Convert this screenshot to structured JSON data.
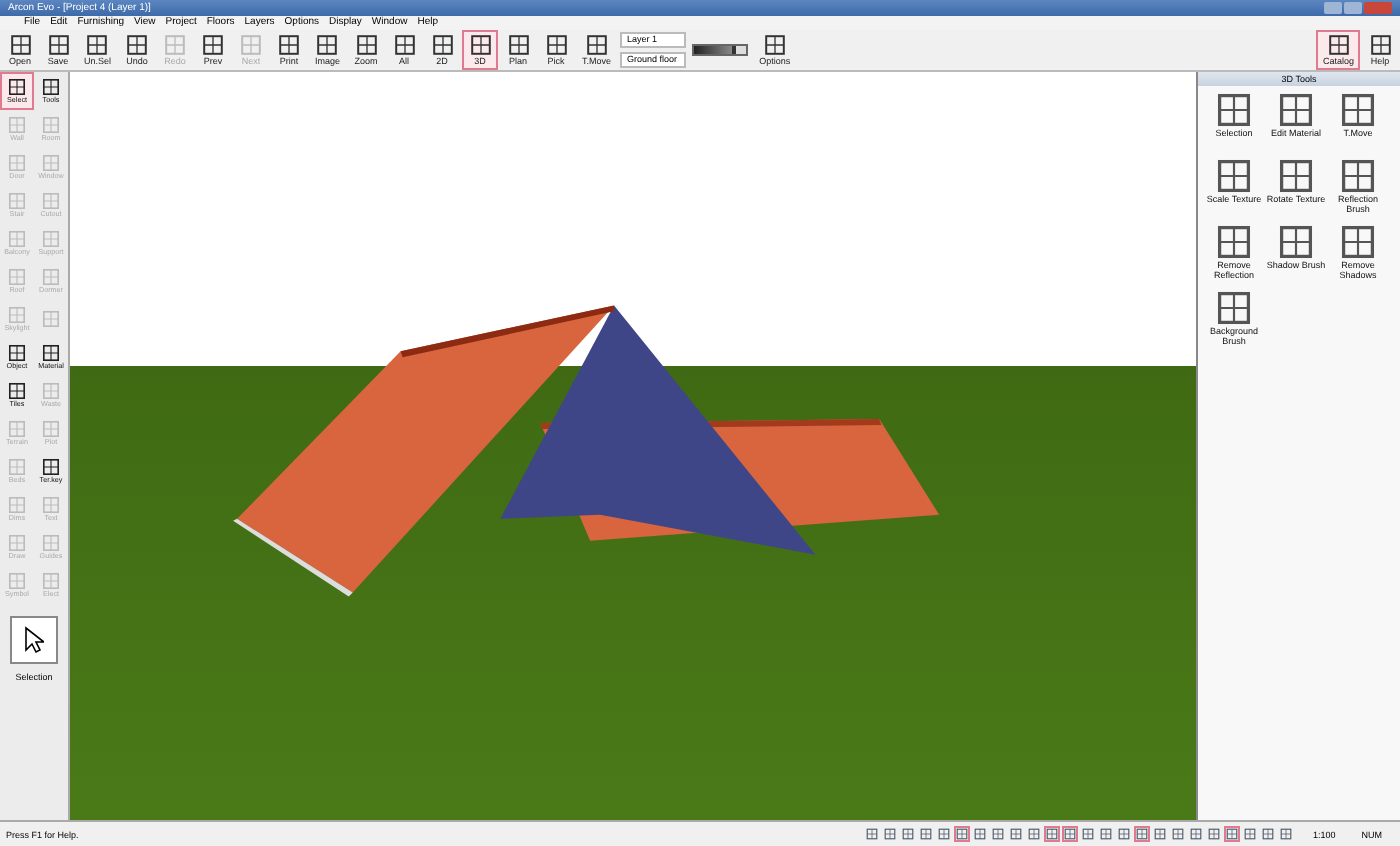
{
  "window": {
    "title": "Arcon Evo - [Project 4 (Layer 1)]"
  },
  "menu": [
    "File",
    "Edit",
    "Furnishing",
    "View",
    "Project",
    "Floors",
    "Layers",
    "Options",
    "Display",
    "Window",
    "Help"
  ],
  "toolbar": [
    {
      "label": "Open",
      "disabled": false,
      "selected": false
    },
    {
      "label": "Save",
      "disabled": false,
      "selected": false
    },
    {
      "label": "Un.Sel",
      "disabled": false,
      "selected": false
    },
    {
      "label": "Undo",
      "disabled": false,
      "selected": false
    },
    {
      "label": "Redo",
      "disabled": true,
      "selected": false
    },
    {
      "label": "Prev",
      "disabled": false,
      "selected": false
    },
    {
      "label": "Next",
      "disabled": true,
      "selected": false
    },
    {
      "label": "Print",
      "disabled": false,
      "selected": false
    },
    {
      "label": "Image",
      "disabled": false,
      "selected": false
    },
    {
      "label": "Zoom",
      "disabled": false,
      "selected": false
    },
    {
      "label": "All",
      "disabled": false,
      "selected": false
    },
    {
      "label": "2D",
      "disabled": false,
      "selected": false
    },
    {
      "label": "3D",
      "disabled": false,
      "selected": true
    },
    {
      "label": "Plan",
      "disabled": false,
      "selected": false
    },
    {
      "label": "Pick",
      "disabled": false,
      "selected": false
    },
    {
      "label": "T.Move",
      "disabled": false,
      "selected": false
    }
  ],
  "layer_select": "Layer 1",
  "floor_select": "Ground floor",
  "zoom_slider": {
    "level": 0.75
  },
  "options_button": "Options",
  "right_toolbar": [
    {
      "label": "Catalog",
      "selected": true
    },
    {
      "label": "Help",
      "selected": false
    }
  ],
  "palette": [
    {
      "label": "Select",
      "disabled": false,
      "selected": true
    },
    {
      "label": "Tools",
      "disabled": false,
      "selected": false
    },
    {
      "label": "Wall",
      "disabled": true,
      "selected": false
    },
    {
      "label": "Room",
      "disabled": true,
      "selected": false
    },
    {
      "label": "Door",
      "disabled": true,
      "selected": false
    },
    {
      "label": "Window",
      "disabled": true,
      "selected": false
    },
    {
      "label": "Stair",
      "disabled": true,
      "selected": false
    },
    {
      "label": "Cutout",
      "disabled": true,
      "selected": false
    },
    {
      "label": "Balcony",
      "disabled": true,
      "selected": false
    },
    {
      "label": "Support",
      "disabled": true,
      "selected": false
    },
    {
      "label": "Roof",
      "disabled": true,
      "selected": false
    },
    {
      "label": "Dormer",
      "disabled": true,
      "selected": false
    },
    {
      "label": "Skylight",
      "disabled": true,
      "selected": false
    },
    {
      "disabled": true,
      "selected": false
    },
    {
      "label": "Object",
      "disabled": false,
      "selected": false
    },
    {
      "label": "Material",
      "disabled": false,
      "selected": false
    },
    {
      "label": "Tiles",
      "disabled": false,
      "selected": false
    },
    {
      "label": "Waste",
      "disabled": true,
      "selected": false
    },
    {
      "label": "Terrain",
      "disabled": true,
      "selected": false
    },
    {
      "label": "Plot",
      "disabled": true,
      "selected": false
    },
    {
      "label": "Beds",
      "disabled": true,
      "selected": false
    },
    {
      "label": "Ter.key",
      "disabled": false,
      "selected": false
    },
    {
      "label": "Dims",
      "disabled": true,
      "selected": false
    },
    {
      "label": "Text",
      "disabled": true,
      "selected": false
    },
    {
      "label": "Draw",
      "disabled": true,
      "selected": false
    },
    {
      "label": "Guides",
      "disabled": true,
      "selected": false
    },
    {
      "label": "Symbol",
      "disabled": true,
      "selected": false
    },
    {
      "label": "Elect",
      "disabled": true,
      "selected": false
    }
  ],
  "current_tool": "Selection",
  "panel": {
    "title": "3D Tools",
    "items": [
      "Selection",
      "Edit Material",
      "T.Move",
      "Scale Texture",
      "Rotate Texture",
      "Reflection Brush",
      "Remove Reflection",
      "Shadow Brush",
      "Remove Shadows",
      "Background Brush"
    ]
  },
  "status_bar": {
    "help": "Press F1 for Help.",
    "toggles": [
      {
        "selected": false
      },
      {
        "selected": false
      },
      {
        "selected": false
      },
      {
        "selected": false
      },
      {
        "selected": false
      },
      {
        "selected": true
      },
      {
        "selected": false
      },
      {
        "selected": false
      },
      {
        "selected": false
      },
      {
        "selected": false
      },
      {
        "selected": true
      },
      {
        "selected": true
      },
      {
        "selected": false
      },
      {
        "selected": false
      },
      {
        "selected": false
      },
      {
        "selected": true
      },
      {
        "selected": false
      },
      {
        "selected": false
      },
      {
        "selected": false
      },
      {
        "selected": false
      },
      {
        "selected": true
      },
      {
        "selected": false
      },
      {
        "selected": false
      },
      {
        "selected": false
      }
    ],
    "scale": "1:100",
    "num": "NUM"
  }
}
